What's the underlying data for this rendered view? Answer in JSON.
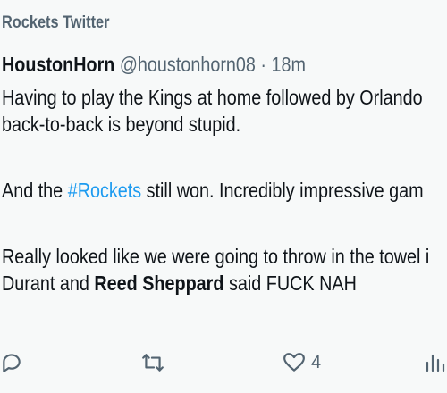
{
  "context_label": "Rockets Twitter",
  "tweet": {
    "author_name": "HoustonHorn",
    "author_handle": "@houstonhorn08",
    "separator": "·",
    "time": "18m",
    "line1": "Having to play the Kings at home followed by Orlando",
    "line2": "back-to-back is beyond stupid.",
    "line3_before": "And the ",
    "line3_hashtag": "#Rockets",
    "line3_after": " still won. Incredibly impressive gam",
    "line4": "Really looked like we were going to throw in the towel i",
    "line5_before": "Durant and ",
    "line5_bold": "Reed Sheppard",
    "line5_after": " said FUCK NAH"
  },
  "actions": {
    "like_count": "4"
  },
  "icons": [
    "reply-icon",
    "retweet-icon",
    "like-icon",
    "views-icon"
  ],
  "colors": {
    "hashtag": "#1d9bf0",
    "muted": "#536471",
    "text": "#0f1419",
    "background": "#f7f9f9"
  }
}
